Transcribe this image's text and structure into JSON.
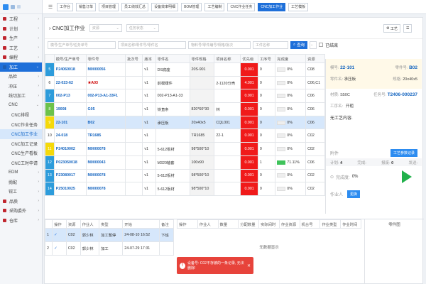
{
  "sidebar": {
    "items": [
      {
        "label": "工程"
      },
      {
        "label": "计划"
      },
      {
        "label": "生产"
      },
      {
        "label": "工艺"
      },
      {
        "label": "编程"
      },
      {
        "label": "加工"
      },
      {
        "label": "品检"
      },
      {
        "label": "冲压"
      },
      {
        "label": "线切加工"
      },
      {
        "label": "CNC"
      },
      {
        "label": "CNC排程"
      },
      {
        "label": "CNC作业任务"
      },
      {
        "label": "CNC加工作业"
      },
      {
        "label": "CNC加工记录"
      },
      {
        "label": "CNC生产看板"
      },
      {
        "label": "CNC工时申请"
      },
      {
        "label": "EDM"
      },
      {
        "label": "抛配"
      },
      {
        "label": "钳工"
      },
      {
        "label": "品质"
      },
      {
        "label": "采购委外"
      },
      {
        "label": "仓库"
      }
    ]
  },
  "topbar": {
    "tabs": [
      {
        "label": "工作台"
      },
      {
        "label": "销售订单"
      },
      {
        "label": "项目管理"
      },
      {
        "label": "员工绩效汇总"
      },
      {
        "label": "设备效率明细"
      },
      {
        "label": "BOM管理"
      },
      {
        "label": "工艺编制"
      },
      {
        "label": "CNC作业任务"
      },
      {
        "label": "CNC加工作业"
      },
      {
        "label": "工艺模板"
      }
    ]
  },
  "header": {
    "title": "CNC加工作业",
    "filter1": "资源",
    "filter2": "任务状态",
    "right_btn1": "工艺",
    "right_btn2": "☰"
  },
  "search": {
    "ph1": "模号/生产单号/任务单号",
    "ph2": "项目名称/零件号/零件名",
    "ph3": "物料号/零件编号/规格/批次",
    "ph4": "工件名称",
    "query": "查询",
    "finished": "已结束"
  },
  "grid": {
    "headers": [
      "",
      "模号/生产单号",
      "零件号",
      "批次号",
      "版本",
      "零件名",
      "零件规格",
      "项目名称",
      "优先级",
      "工序号",
      "完成度",
      "资源"
    ],
    "rows": [
      {
        "marker": "5",
        "order": "P24060018",
        "part": "M0000056",
        "batch": "",
        "ver": "v1",
        "name": "DS底座",
        "spec": "20S-901",
        "proj": "",
        "prio": "0.001",
        "step": "0",
        "pct": "0%",
        "res": "C08"
      },
      {
        "marker": "6",
        "order": "22-023-62",
        "part": "★A03",
        "batch": "",
        "ver": "v1",
        "name": "前模镶件",
        "spec": "",
        "proj": "2-1120分壳",
        "prio": "4.001",
        "step": "0",
        "pct": "0%",
        "res": "C06,C1"
      },
      {
        "marker": "7",
        "order": "002-P13",
        "part": "002-P13-A1-33F1",
        "batch": "",
        "ver": "v1",
        "name": "002-P13-A1-33",
        "spec": "",
        "proj": "",
        "prio": "0.001",
        "step": "0",
        "pct": "0%",
        "res": "C06"
      },
      {
        "marker": "8",
        "order": "19008",
        "part": "G05",
        "batch": "",
        "ver": "v1",
        "name": "铁直条",
        "spec": "820*60*30",
        "proj": "林",
        "prio": "0.001",
        "step": "0",
        "pct": "0%",
        "res": "C06"
      },
      {
        "marker": "9",
        "order": "22-101",
        "part": "B02",
        "batch": "",
        "ver": "v1",
        "name": "承压板",
        "spec": "20x40x5",
        "proj": "CQL001",
        "prio": "0.001",
        "step": "0",
        "pct": "0%",
        "res": "C06"
      },
      {
        "marker": "10",
        "order": "24-018",
        "part": "TR1685",
        "batch": "",
        "ver": "v1",
        "name": "",
        "spec": "TR1685",
        "proj": "22-1",
        "prio": "0.001",
        "step": "0",
        "pct": "0%",
        "res": "C02"
      },
      {
        "marker": "11",
        "order": "P24010002",
        "part": "M0000078",
        "batch": "",
        "ver": "v1",
        "name": "5-612板材",
        "spec": "98*500*10",
        "proj": "",
        "prio": "0.001",
        "step": "0",
        "pct": "0%",
        "res": "C02"
      },
      {
        "marker": "12",
        "order": "P023050018",
        "part": "M0000043",
        "batch": "",
        "ver": "v1",
        "name": "M320轴套",
        "spec": "100x90",
        "proj": "",
        "prio": "0.001",
        "step": "1",
        "pct": "71.11%",
        "res": "C06"
      },
      {
        "marker": "13",
        "order": "P23080017",
        "part": "M0000078",
        "batch": "",
        "ver": "v1",
        "name": "5-612板材",
        "spec": "98*500*10",
        "proj": "",
        "prio": "0.001",
        "step": "0",
        "pct": "0%",
        "res": "C02"
      },
      {
        "marker": "14",
        "order": "P25010025",
        "part": "M0000078",
        "batch": "",
        "ver": "v1",
        "name": "5-612板材",
        "spec": "98*500*10",
        "proj": "",
        "prio": "0.001",
        "step": "0",
        "pct": "0%",
        "res": "C02"
      }
    ]
  },
  "detail": {
    "mold_label": "模号:",
    "mold": "22-101",
    "part_label": "零件号:",
    "part": "B02",
    "name_label": "零件名:",
    "name": "承压板",
    "spec_label": "规格:",
    "spec": "20x40x5",
    "mat_label": "材质:",
    "mat": "S50C",
    "task_label": "任务号:",
    "task": "T2406-000237",
    "step_label": "工序名:",
    "step": "开粗",
    "content": "无工艺内容.",
    "attach": "附件",
    "process_btn": "工艺参数记录",
    "plan_label": "计划:",
    "plan": "4",
    "done_label": "完成:",
    "done": "",
    "report_label": "报废:",
    "report": "0",
    "send_label": "发送:",
    "send": "",
    "pct_label": "完成度:",
    "pct": "0%",
    "worker_label": "作业人",
    "change_btn": "更换"
  },
  "lower": {
    "headers": [
      "",
      "操作",
      "资源",
      "作业人",
      "类型",
      "开始",
      "备注"
    ],
    "rows": [
      {
        "no": "1",
        "op": "✓",
        "res": "C02",
        "worker": "郭少林",
        "type": "加工暂停",
        "start": "24-08-10 16:52",
        "note": "下班"
      },
      {
        "no": "2",
        "op": "✓",
        "res": "C02",
        "worker": "郭少林",
        "type": "加工",
        "start": "24-07-29 17:31",
        "note": ""
      }
    ],
    "headers2": [
      "操作",
      "作业人",
      "数量",
      "分配数量",
      "实际间时",
      "作业资源",
      "机台号",
      "作业类型",
      "作业时间"
    ],
    "empty": "无数据显示",
    "parts_header": "零件图"
  },
  "toast": {
    "icon": "!",
    "text": "设备号: C02不存被的一条记录, 无法删除!",
    "close": "✕"
  }
}
